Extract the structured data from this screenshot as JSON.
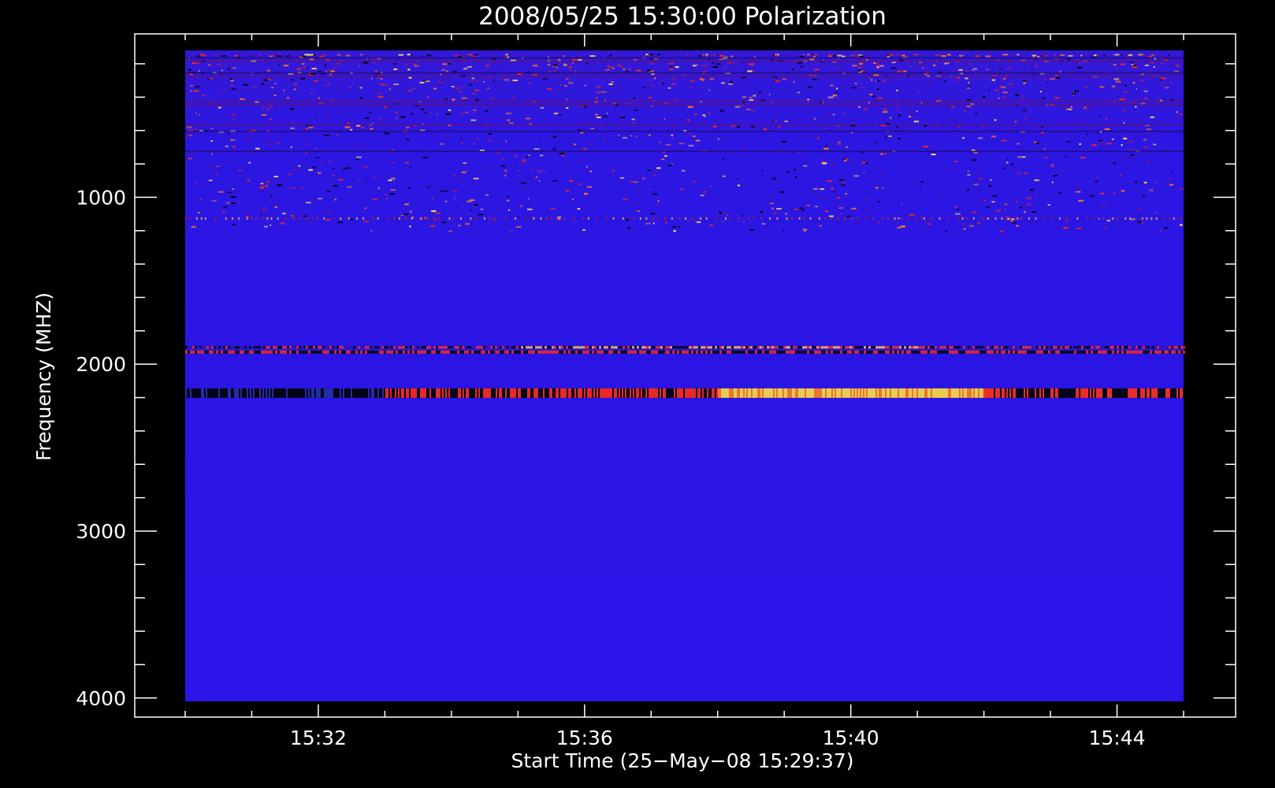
{
  "chart_data": {
    "type": "heatmap",
    "title": "2008/05/25 15:30:00 Polarization",
    "xlabel": "Start Time (25−May−08 15:29:37)",
    "ylabel": "Frequency (MHZ)",
    "x_ticks": [
      {
        "label": "15:32",
        "minutes": 2
      },
      {
        "label": "15:36",
        "minutes": 6
      },
      {
        "label": "15:40",
        "minutes": 10
      },
      {
        "label": "15:44",
        "minutes": 14
      }
    ],
    "y_ticks": [
      1000,
      2000,
      3000,
      4000
    ],
    "ylim": [
      120,
      4020
    ],
    "y_reversed": true,
    "xlim_minutes": [
      0,
      15
    ],
    "colors": {
      "background": "#000000",
      "axis": "#ffffff",
      "heatmap_base": "#2a14e6",
      "low": "#000000",
      "mid": "#ff3010",
      "high": "#ffff66"
    },
    "features": [
      {
        "desc": "noisy interference band",
        "freq_range": [
          140,
          1200
        ]
      },
      {
        "desc": "band near 1900 MHz",
        "freq": 1910,
        "bright_between_minutes": [
          5,
          11
        ]
      },
      {
        "desc": "bright band near 2180 MHz",
        "freq": 2180,
        "peak_between_minutes": [
          9,
          12
        ]
      }
    ]
  }
}
